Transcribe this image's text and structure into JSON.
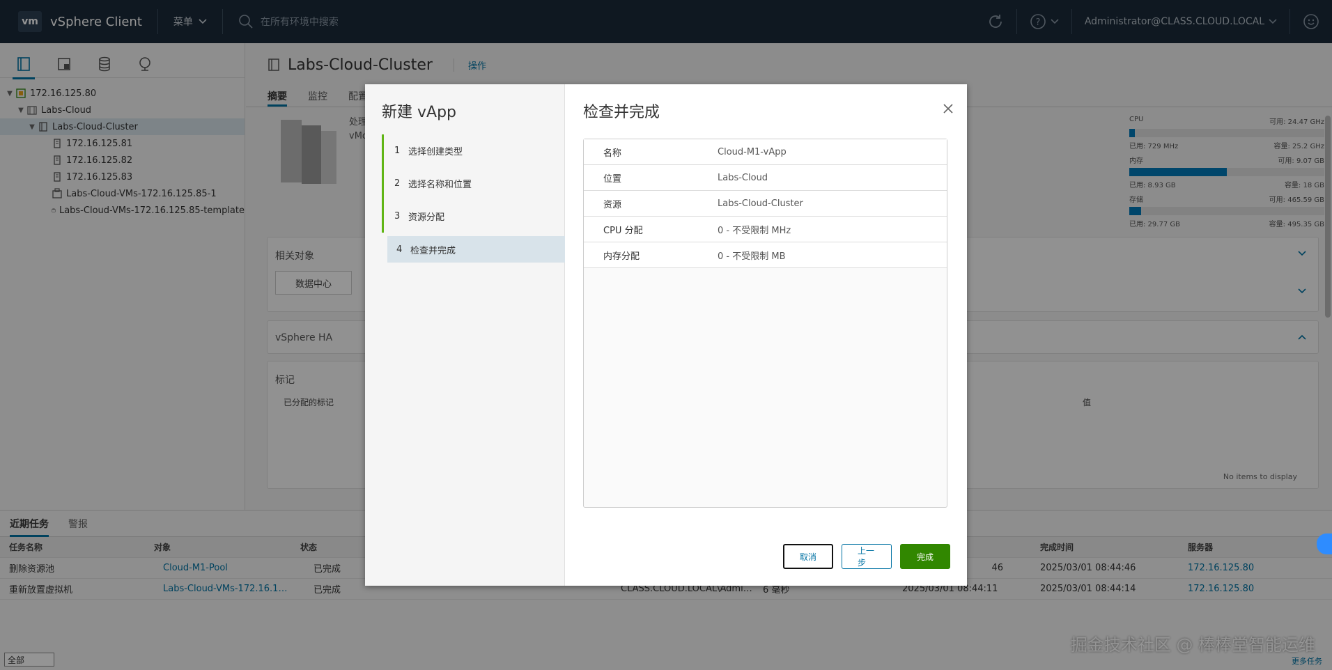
{
  "header": {
    "logo": "vm",
    "app_title": "vSphere Client",
    "menu_label": "菜单",
    "search_placeholder": "在所有环境中搜索",
    "user": "Administrator@CLASS.CLOUD.LOCAL"
  },
  "tree": {
    "items": [
      {
        "label": "172.16.125.80",
        "level": 0,
        "expanded": true
      },
      {
        "label": "Labs-Cloud",
        "level": 1,
        "expanded": true
      },
      {
        "label": "Labs-Cloud-Cluster",
        "level": 2,
        "expanded": true,
        "selected": true
      },
      {
        "label": "172.16.125.81",
        "level": 3
      },
      {
        "label": "172.16.125.82",
        "level": 3
      },
      {
        "label": "172.16.125.83",
        "level": 3
      },
      {
        "label": "Labs-Cloud-VMs-172.16.125.85-1",
        "level": 2
      },
      {
        "label": "Labs-Cloud-VMs-172.16.125.85-template",
        "level": 2
      }
    ]
  },
  "main": {
    "title": "Labs-Cloud-Cluster",
    "actions_label": "操作",
    "tabs": [
      "摘要",
      "监控",
      "配置"
    ],
    "summary_line1": "处理",
    "summary_line2": "vMo",
    "resources": {
      "cpu": {
        "label": "CPU",
        "free": "可用: 24.47 GHz",
        "used": "已用: 729 MHz",
        "capacity": "容量: 25.2 GHz",
        "fill": 0.03
      },
      "mem": {
        "label": "内存",
        "free": "可用: 9.07 GB",
        "used": "已用: 8.93 GB",
        "capacity": "容量: 18 GB",
        "fill": 0.5
      },
      "storage": {
        "label": "存储",
        "free": "可用: 465.59 GB",
        "used": "已用: 29.77 GB",
        "capacity": "容量: 495.35 GB",
        "fill": 0.06
      }
    },
    "related_title": "相关对象",
    "related_datacenter": "数据中心",
    "ha_title": "vSphere HA",
    "tags_title": "标记",
    "tags_col": "已分配的标记",
    "value_col": "值",
    "no_items": "No items to display"
  },
  "modal": {
    "wizard_title": "新建 vApp",
    "steps": [
      {
        "num": "1",
        "label": "选择创建类型"
      },
      {
        "num": "2",
        "label": "选择名称和位置"
      },
      {
        "num": "3",
        "label": "资源分配"
      },
      {
        "num": "4",
        "label": "检查并完成"
      }
    ],
    "page_title": "检查并完成",
    "rows": [
      {
        "key": "名称",
        "value": "Cloud-M1-vApp"
      },
      {
        "key": "位置",
        "value": "Labs-Cloud"
      },
      {
        "key": "资源",
        "value": "Labs-Cloud-Cluster"
      },
      {
        "key": "CPU 分配",
        "value": "0 - 不受限制 MHz"
      },
      {
        "key": "内存分配",
        "value": "0 - 不受限制 MB"
      }
    ],
    "cancel": "取消",
    "prev": "上一步",
    "finish": "完成"
  },
  "tasks": {
    "tabs": [
      "近期任务",
      "警报"
    ],
    "columns": [
      "任务名称",
      "对象",
      "状态",
      "完成时间",
      "服务器"
    ],
    "rows": [
      {
        "name": "删除资源池",
        "object": "Cloud-M1-Pool",
        "status": "已完成",
        "initiator": "",
        "queued": "",
        "start": "46",
        "end": "2025/03/01 08:44:46",
        "server": "172.16.125.80"
      },
      {
        "name": "重新放置虚拟机",
        "object": "Labs-Cloud-VMs-172.16.12...",
        "status": "已完成",
        "initiator": "CLASS.CLOUD.LOCAL\\Admini...",
        "queued": "6 毫秒",
        "start": "2025/03/01 08:44:11",
        "end": "2025/03/01 08:44:14",
        "server": "172.16.125.80"
      }
    ],
    "filter": "全部",
    "more": "更多任务"
  },
  "watermark": "掘金技术社区 @ 棒棒堂智能运维"
}
